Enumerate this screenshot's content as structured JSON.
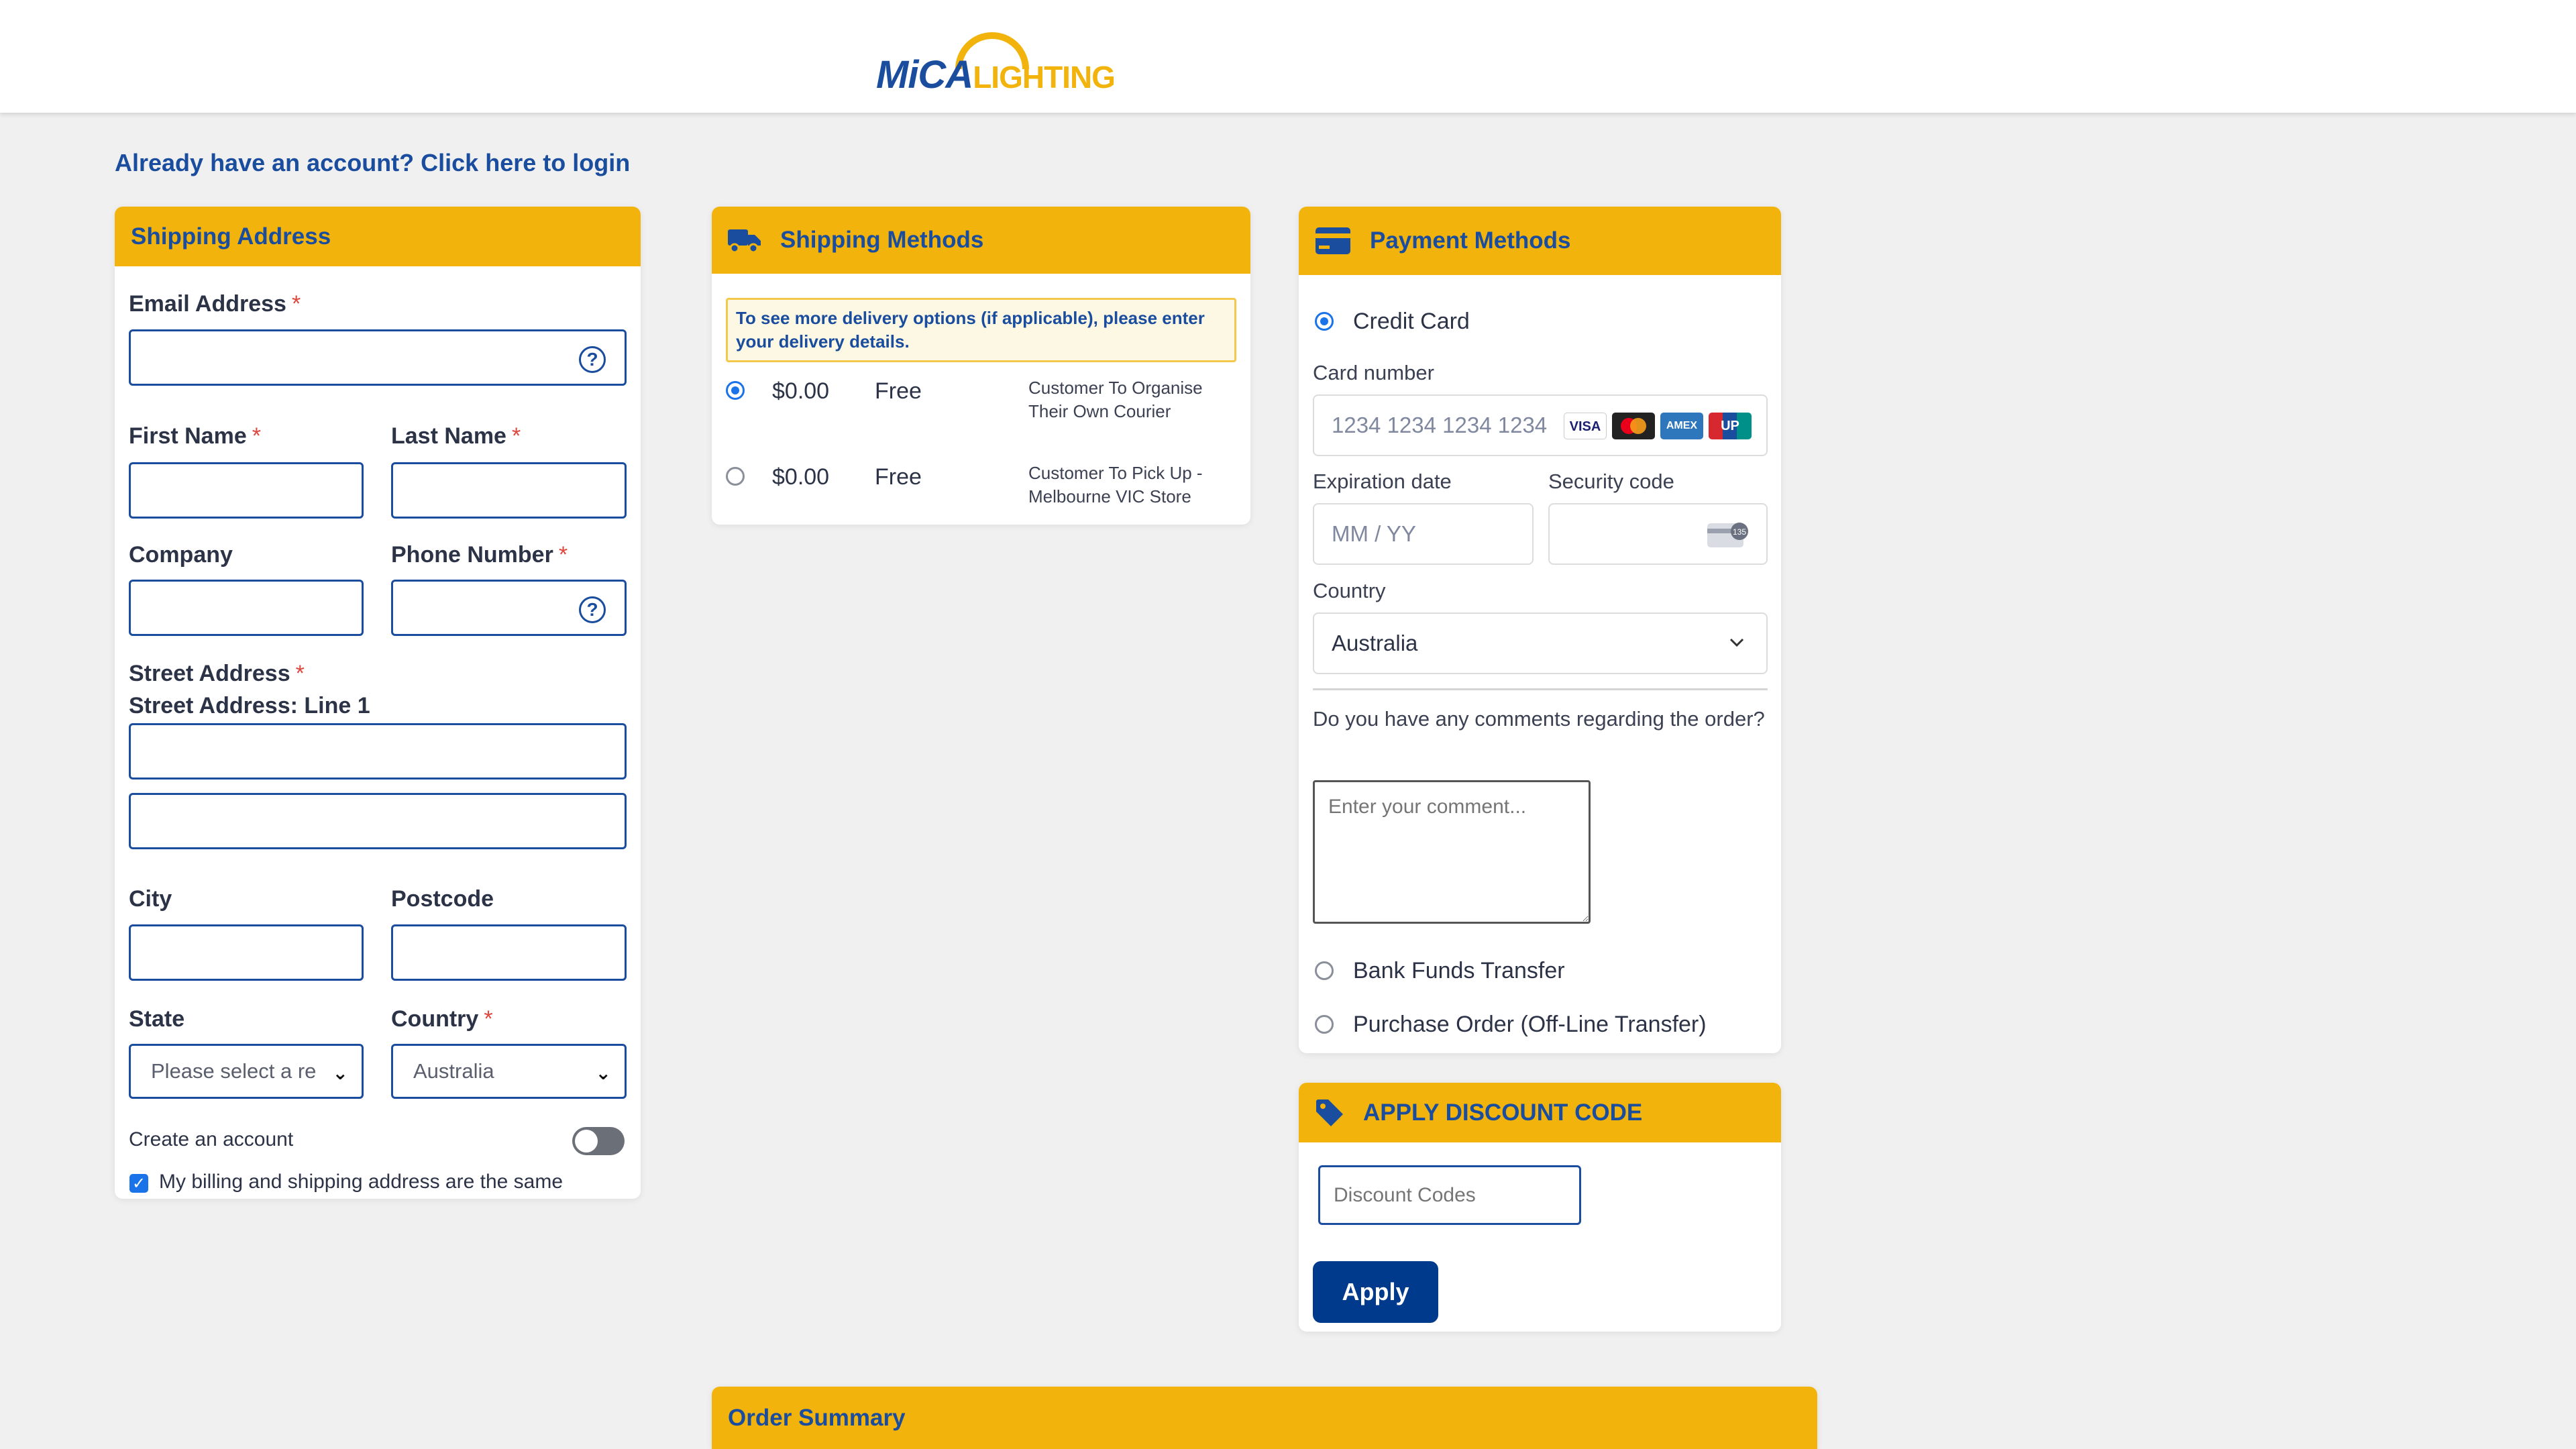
{
  "header": {
    "logo_primary": "MiCA",
    "logo_secondary": "LIGHTING"
  },
  "login_prompt": "Already have an account? Click here to login",
  "shipping_address": {
    "title": "Shipping Address",
    "email_label": "Email Address",
    "first_name_label": "First Name",
    "last_name_label": "Last Name",
    "company_label": "Company",
    "phone_label": "Phone Number",
    "street_label": "Street Address",
    "street_line1_label": "Street Address: Line 1",
    "city_label": "City",
    "postcode_label": "Postcode",
    "state_label": "State",
    "state_value": "Please select a re",
    "country_label": "Country",
    "country_value": "Australia",
    "create_account_label": "Create an account",
    "same_address_label": "My billing and shipping address are the same",
    "required_mark": "*",
    "help_glyph": "?"
  },
  "shipping_methods": {
    "title": "Shipping Methods",
    "notice": "To see more delivery options (if applicable), please enter your delivery details.",
    "options": [
      {
        "price": "$0.00",
        "label": "Free",
        "description": "Customer To Organise Their Own Courier",
        "selected": true
      },
      {
        "price": "$0.00",
        "label": "Free",
        "description": "Customer To Pick Up - Melbourne VIC Store",
        "selected": false
      }
    ]
  },
  "payment_methods": {
    "title": "Payment Methods",
    "credit_card_label": "Credit Card",
    "card_number_label": "Card number",
    "card_number_placeholder": "1234 1234 1234 1234",
    "card_brands": [
      "VISA",
      "MC",
      "AMEX",
      "UP"
    ],
    "expiration_label": "Expiration date",
    "expiration_placeholder": "MM / YY",
    "security_label": "Security code",
    "country_label": "Country",
    "country_value": "Australia",
    "comments_label": "Do you have any comments regarding the order?",
    "comments_placeholder": "Enter your comment...",
    "bank_transfer_label": "Bank Funds Transfer",
    "purchase_order_label": "Purchase Order (Off-Line Transfer)"
  },
  "discount": {
    "title": "APPLY DISCOUNT CODE",
    "placeholder": "Discount Codes",
    "apply_label": "Apply"
  },
  "order_summary": {
    "title": "Order Summary"
  },
  "colors": {
    "accent": "#f2b40c",
    "brand_blue": "#1a4d9e",
    "button_blue": "#003a8c"
  }
}
